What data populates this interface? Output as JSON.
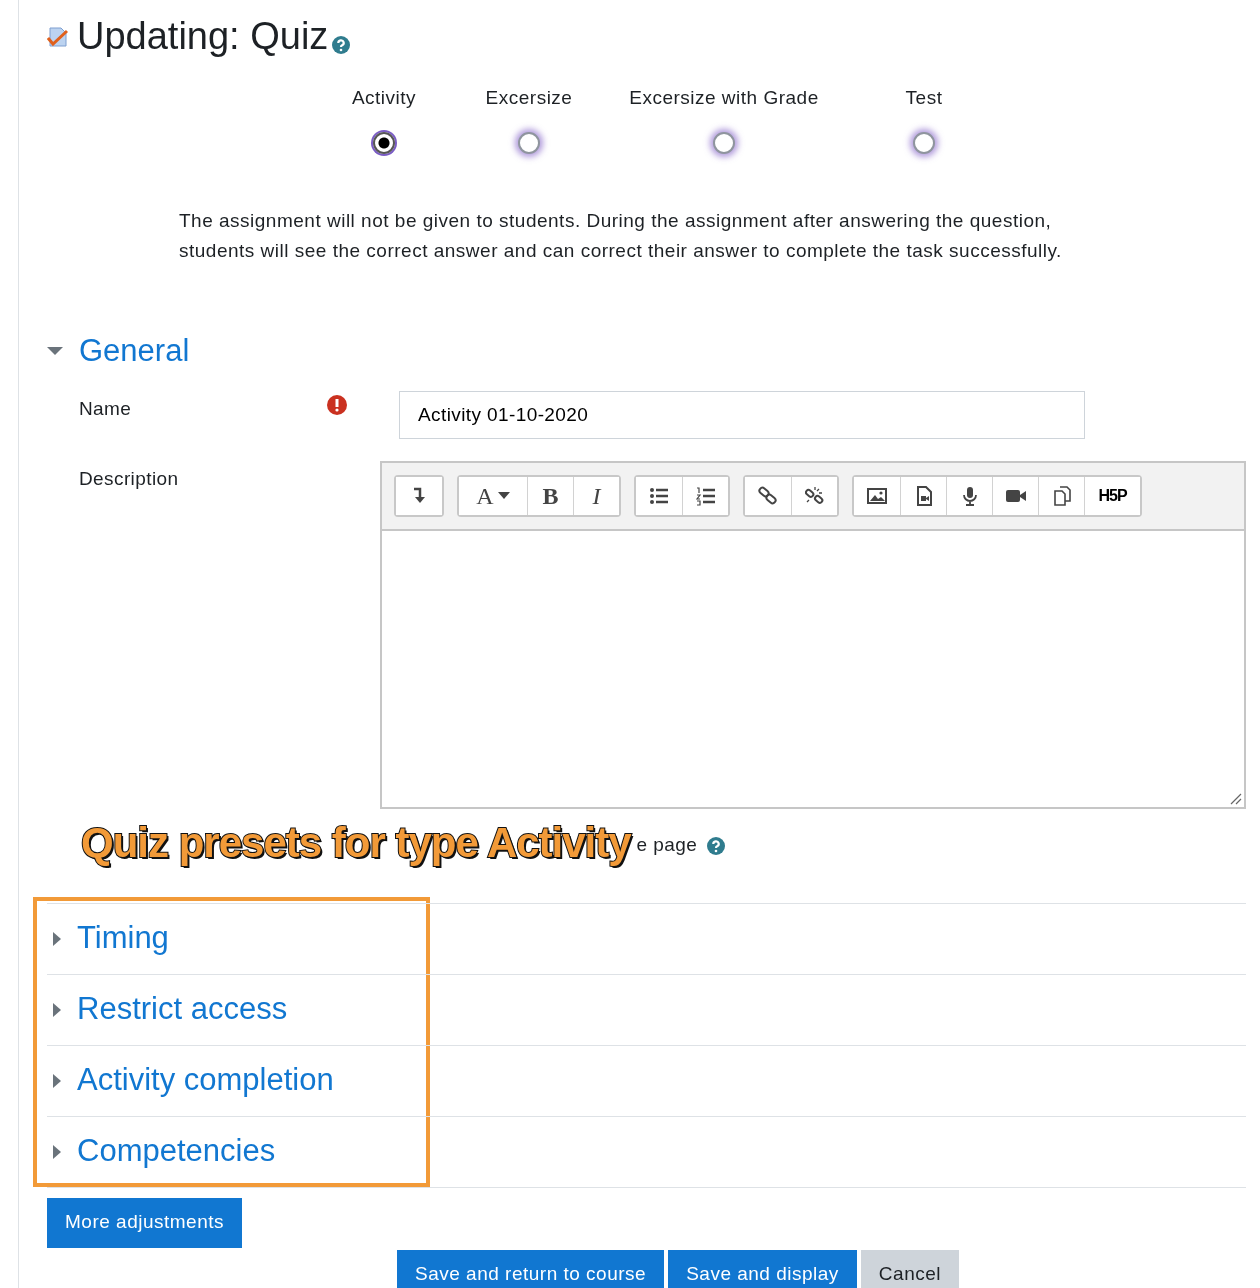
{
  "page": {
    "title": "Updating: Quiz"
  },
  "presets": [
    {
      "label": "Activity",
      "selected": true
    },
    {
      "label": "Excersize",
      "selected": false
    },
    {
      "label": "Excersize with Grade",
      "selected": false
    },
    {
      "label": "Test",
      "selected": false
    }
  ],
  "preset_description": "The assignment will not be given to students. During the assignment after answering the question, students will see the correct answer and can correct their answer to complete the task successfully.",
  "general": {
    "title": "General",
    "expanded": true,
    "name_label": "Name",
    "name_required": true,
    "name_value": "Activity 01-10-2020",
    "description_label": "Description",
    "toolbar": [
      [
        {
          "kind": "icon"
        }
      ],
      [
        {
          "kind": "glyph",
          "text": "A"
        },
        {
          "kind": "glyph",
          "text": "B"
        },
        {
          "kind": "glyph",
          "text": "I"
        }
      ],
      [
        {
          "kind": "icon"
        },
        {
          "kind": "icon"
        }
      ],
      [
        {
          "kind": "icon"
        },
        {
          "kind": "icon"
        }
      ],
      [
        {
          "kind": "icon"
        },
        {
          "kind": "icon"
        },
        {
          "kind": "icon"
        },
        {
          "kind": "icon"
        },
        {
          "kind": "icon"
        },
        {
          "kind": "glyph",
          "text": "H5P"
        }
      ]
    ],
    "display_label_visible": "e page"
  },
  "annotation": {
    "text": "Quiz presets for type Activity"
  },
  "sections": [
    {
      "title": "Timing",
      "expanded": false
    },
    {
      "title": "Restrict access",
      "expanded": false
    },
    {
      "title": "Activity completion",
      "expanded": false
    },
    {
      "title": "Competencies",
      "expanded": false
    }
  ],
  "more_button": "More adjustments",
  "buttons": [
    {
      "label": "Save and return to course",
      "kind": "primary"
    },
    {
      "label": "Save and display",
      "kind": "primary"
    },
    {
      "label": "Cancel",
      "kind": "secondary"
    }
  ]
}
